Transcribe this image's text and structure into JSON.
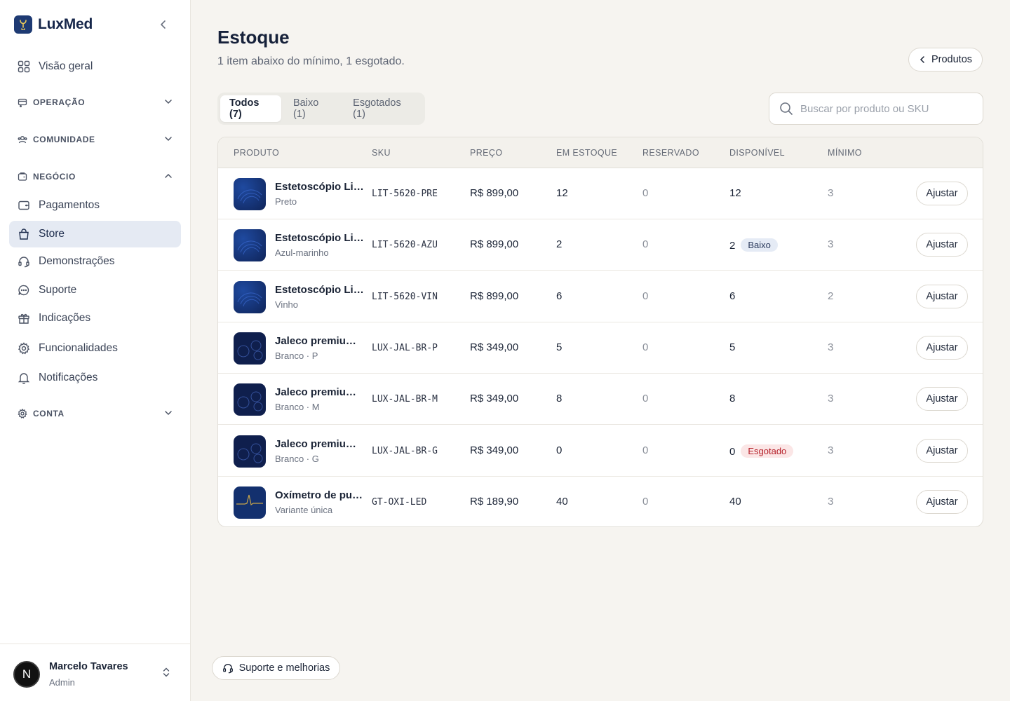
{
  "brand": {
    "name": "LuxMed"
  },
  "sidebar": {
    "items": [
      {
        "label": "Visão geral",
        "icon": "grid-icon"
      },
      {
        "label": "Pagamentos",
        "icon": "wallet-icon"
      },
      {
        "label": "Store",
        "icon": "shopping-bag-icon",
        "active": true
      },
      {
        "label": "Demonstrações",
        "icon": "headset-icon"
      },
      {
        "label": "Suporte",
        "icon": "chat-bubble-icon"
      },
      {
        "label": "Indicações",
        "icon": "gift-icon"
      },
      {
        "label": "Funcionalidades",
        "icon": "settings-icon"
      },
      {
        "label": "Notificações",
        "icon": "bell-icon"
      }
    ],
    "sections": {
      "operacao": "OPERAÇÃO",
      "comunidade": "COMUNIDADE",
      "negocio": "NEGÓCIO",
      "conta": "CONTA"
    }
  },
  "user": {
    "name": "Marcelo Tavares",
    "role": "Admin",
    "initial": "N"
  },
  "page": {
    "title": "Estoque",
    "subtitle": "1 item abaixo do mínimo, 1 esgotado.",
    "back_label": "Produtos"
  },
  "tabs": [
    {
      "label": "Todos (7)",
      "active": true
    },
    {
      "label": "Baixo (1)"
    },
    {
      "label": "Esgotados (1)"
    }
  ],
  "search": {
    "placeholder": "Buscar por produto ou SKU",
    "value": ""
  },
  "table": {
    "headers": {
      "produto": "PRODUTO",
      "sku": "SKU",
      "preco": "PREÇO",
      "em_estoque": "EM ESTOQUE",
      "reservado": "RESERVADO",
      "disponivel": "DISPONÍVEL",
      "minimo": "MÍNIMO"
    },
    "adjust_label": "Ajustar",
    "rows": [
      {
        "name": "Estetoscópio Littmann Cardiology IV",
        "variant": "Preto",
        "sku": "LIT-5620-PRE",
        "price": "R$ 899,00",
        "stock": "12",
        "reserved": "0",
        "available": "12",
        "badge": "",
        "minimum": "3",
        "thumb": "stethoscope"
      },
      {
        "name": "Estetoscópio Littmann Cardiology IV",
        "variant": "Azul-marinho",
        "sku": "LIT-5620-AZU",
        "price": "R$ 899,00",
        "stock": "2",
        "reserved": "0",
        "available": "2",
        "badge": "Baixo",
        "minimum": "3",
        "thumb": "stethoscope"
      },
      {
        "name": "Estetoscópio Littmann Cardiology IV",
        "variant": "Vinho",
        "sku": "LIT-5620-VIN",
        "price": "R$ 899,00",
        "stock": "6",
        "reserved": "0",
        "available": "6",
        "badge": "",
        "minimum": "2",
        "thumb": "stethoscope"
      },
      {
        "name": "Jaleco premium LuxMed",
        "variant": "Branco · P",
        "sku": "LUX-JAL-BR-P",
        "price": "R$ 349,00",
        "stock": "5",
        "reserved": "0",
        "available": "5",
        "badge": "",
        "minimum": "3",
        "thumb": "coat"
      },
      {
        "name": "Jaleco premium LuxMed",
        "variant": "Branco · M",
        "sku": "LUX-JAL-BR-M",
        "price": "R$ 349,00",
        "stock": "8",
        "reserved": "0",
        "available": "8",
        "badge": "",
        "minimum": "3",
        "thumb": "coat"
      },
      {
        "name": "Jaleco premium LuxMed",
        "variant": "Branco · G",
        "sku": "LUX-JAL-BR-G",
        "price": "R$ 349,00",
        "stock": "0",
        "reserved": "0",
        "available": "0",
        "badge": "Esgotado",
        "minimum": "3",
        "thumb": "coat"
      },
      {
        "name": "Oxímetro de pulso LED",
        "variant": "Variante única",
        "sku": "GT-OXI-LED",
        "price": "R$ 189,90",
        "stock": "40",
        "reserved": "0",
        "available": "40",
        "badge": "",
        "minimum": "3",
        "thumb": "oximeter"
      }
    ]
  },
  "footer": {
    "support_label": "Suporte e melhorias"
  }
}
